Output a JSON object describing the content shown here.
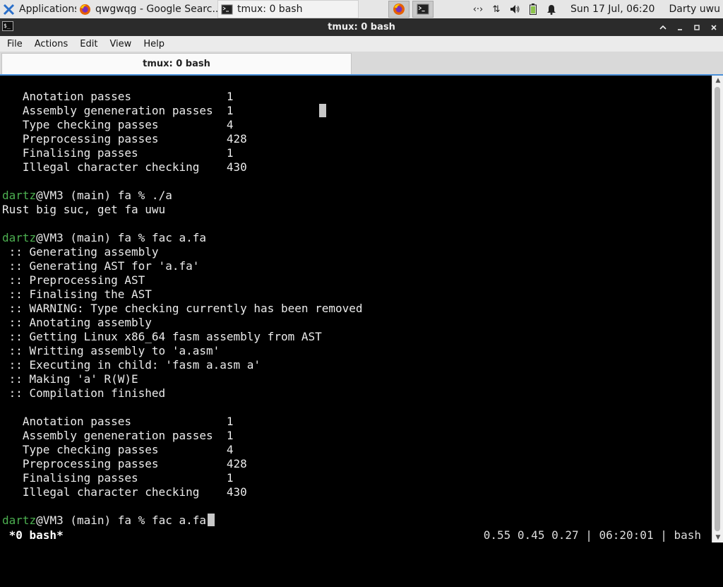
{
  "panel": {
    "apps_label": "Applications",
    "tasks": [
      {
        "label": "qwgwqg - Google Searc..."
      },
      {
        "label": "tmux: 0 bash"
      }
    ],
    "clock": "Sun 17 Jul, 06:20",
    "user": "Darty uwu"
  },
  "window": {
    "title": "tmux: 0 bash",
    "menus": [
      "File",
      "Actions",
      "Edit",
      "View",
      "Help"
    ],
    "tab_label": "tmux: 0 bash"
  },
  "terminal": {
    "lines": [
      {
        "prompt": "",
        "text": "   Anotation passes              1"
      },
      {
        "prompt": "",
        "text": "   Assembly geneneration passes  1"
      },
      {
        "prompt": "",
        "text": "   Type checking passes          4"
      },
      {
        "prompt": "",
        "text": "   Preprocessing passes          428"
      },
      {
        "prompt": "",
        "text": "   Finalising passes             1"
      },
      {
        "prompt": "",
        "text": "   Illegal character checking    430"
      },
      {
        "prompt": "",
        "text": ""
      },
      {
        "prompt": "dartz",
        "text": "@VM3 (main) fa % ./a"
      },
      {
        "prompt": "",
        "text": "Rust big suc, get fa uwu"
      },
      {
        "prompt": "",
        "text": ""
      },
      {
        "prompt": "dartz",
        "text": "@VM3 (main) fa % fac a.fa"
      },
      {
        "prompt": "",
        "text": " :: Generating assembly"
      },
      {
        "prompt": "",
        "text": " :: Generating AST for 'a.fa'"
      },
      {
        "prompt": "",
        "text": " :: Preprocessing AST"
      },
      {
        "prompt": "",
        "text": " :: Finalising the AST"
      },
      {
        "prompt": "",
        "text": " :: WARNING: Type checking currently has been removed"
      },
      {
        "prompt": "",
        "text": " :: Anotating assembly"
      },
      {
        "prompt": "",
        "text": " :: Getting Linux x86_64 fasm assembly from AST"
      },
      {
        "prompt": "",
        "text": " :: Writting assembly to 'a.asm'"
      },
      {
        "prompt": "",
        "text": " :: Executing in child: 'fasm a.asm a'"
      },
      {
        "prompt": "",
        "text": " :: Making 'a' R(W)E"
      },
      {
        "prompt": "",
        "text": " :: Compilation finished"
      },
      {
        "prompt": "",
        "text": ""
      },
      {
        "prompt": "",
        "text": "   Anotation passes              1"
      },
      {
        "prompt": "",
        "text": "   Assembly geneneration passes  1"
      },
      {
        "prompt": "",
        "text": "   Type checking passes          4"
      },
      {
        "prompt": "",
        "text": "   Preprocessing passes          428"
      },
      {
        "prompt": "",
        "text": "   Finalising passes             1"
      },
      {
        "prompt": "",
        "text": "   Illegal character checking    430"
      },
      {
        "prompt": "",
        "text": ""
      },
      {
        "prompt": "dartz",
        "text": "@VM3 (main) fa % fac a.fa"
      }
    ],
    "status_left": " *0 bash*",
    "status_right": "0.55 0.45 0.27 | 06:20:01 | bash"
  },
  "colors": {
    "prompt_user": "#4caf50",
    "terminal_bg": "#000000",
    "terminal_fg": "#ebebeb",
    "tab_accent": "#4a90d9"
  }
}
